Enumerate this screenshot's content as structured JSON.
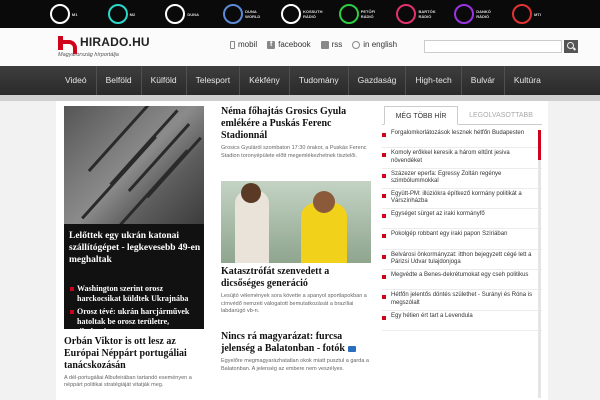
{
  "channels": [
    {
      "name": "M1",
      "color": "#ffffff"
    },
    {
      "name": "M2",
      "color": "#2dd7c9"
    },
    {
      "name": "DUNA",
      "color": "#ffffff"
    },
    {
      "name": "DUNA WORLD",
      "color": "#5b8ad6"
    },
    {
      "name": "KOSSUTH RÁDIÓ",
      "color": "#ffffff"
    },
    {
      "name": "PETŐFI RÁDIÓ",
      "color": "#2ecc40"
    },
    {
      "name": "BARTÓK RÁDIÓ",
      "color": "#e2336e"
    },
    {
      "name": "DANKÓ RÁDIÓ",
      "color": "#9a33e2"
    },
    {
      "name": "MTI",
      "color": "#e23333"
    }
  ],
  "header": {
    "brand": "HIRADO.HU",
    "tagline": "Magyarország hírportálja",
    "links": {
      "mobil": "mobil",
      "facebook": "facebook",
      "rss": "rss",
      "english": "in english"
    },
    "accent": "#d0021b"
  },
  "nav": [
    "Videó",
    "Belföld",
    "Külföld",
    "Telesport",
    "Kékfény",
    "Tudomány",
    "Gazdaság",
    "High-tech",
    "Bulvár",
    "Kultúra"
  ],
  "featured": {
    "title": "Lelőttek egy ukrán katonai szállítógépet - legkevesebb 49-en meghaltak",
    "subs": [
      "Washington szerint orosz harckocsikat küldtek Ukrajnába",
      "Orosz tévé: ukrán harcjárművek hatoltak be orosz területre, tiltakozás"
    ]
  },
  "left_article": {
    "title": "Orbán Viktor is ott lesz az Európai Néppárt portugáliai tanácskozásán",
    "text": "A dél-portugáliai Albufeirában tartandó eseményen a néppárt politikai stratégiáját vitatják meg."
  },
  "middle": {
    "a1_title": "Néma főhajtás Grosics Gyula emlékére a Puskás Ferenc Stadionnál",
    "a1_text": "Grosics Gyuláról szombaton 17:30 órakor, a Puskás Ferenc Stadion toronyépülete előtt megemlékezhetnek tisztelői.",
    "a2_title": "Katasztrófát szenvedett a dicsőséges generáció",
    "a2_text": "Lesújtó vélemények sora követte a spanyol sportlapokban a címvédő nemzeti válogatott bemutatkozását a brazíliai labdarúgó vb-n.",
    "a3_title": "Nincs rá magyarázat: furcsa jelenség a Balatonban - fotók",
    "a3_text": "Egyelőre megmagyarázhatatlan okok miatt pusztul a garda a Balatonban. A jelenség az embere nem veszélyes."
  },
  "sidebar": {
    "tab_active": "MÉG TÖBB HÍR",
    "tab_inactive": "LEGOLVASOTTABB",
    "items": [
      "Forgalomkorlátozások lesznek hétfőn Budapesten",
      "Komoly erőkkel keresik a három eltűnt jesiva növendéket",
      "Százezer eperfa: Egressy Zoltán regénye szimbólummokkal",
      "Együtt-PM: illúziókra építkező kormány politikát a Várszínházba",
      "Egységet sürget az iraki kormányfő",
      "Pokolgép robbant egy iraki papon Szíriában",
      "Belvárosi önkormányzat: itthon bejegyzett cégé lett a Párizsi Udvar tulajdonjoga",
      "Megvédte a Benes-dekrétumokat egy cseh politikus",
      "Hétfőn jelentős döntés születhet - Surányi és Róna is megszólalt",
      "Egy hétien ért tart a Levendula"
    ]
  }
}
